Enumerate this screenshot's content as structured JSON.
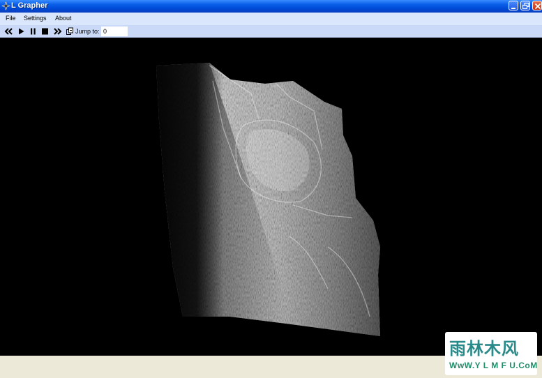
{
  "window": {
    "title": "L Grapher",
    "icons": {
      "app": "app-icon",
      "minimize": "minimize-icon",
      "restore": "restore-icon",
      "close": "close-icon"
    },
    "colors": {
      "titlebar": "#0054e3",
      "menubar": "#d9e6fb",
      "toolbar": "#c9d9f7",
      "canvas": "#000000",
      "frame": "#ece9d8"
    }
  },
  "menu": {
    "items": [
      "File",
      "Settings",
      "About"
    ]
  },
  "toolbar": {
    "buttons": [
      "rewind-icon",
      "play-icon",
      "pause-icon",
      "stop-icon",
      "fast-forward-icon",
      "jump-icon"
    ],
    "jump_label": "Jump to:",
    "jump_value": "0"
  },
  "watermark": {
    "text_cn": "雨林木风",
    "url": "WwW.Y L M F U.CoM"
  }
}
